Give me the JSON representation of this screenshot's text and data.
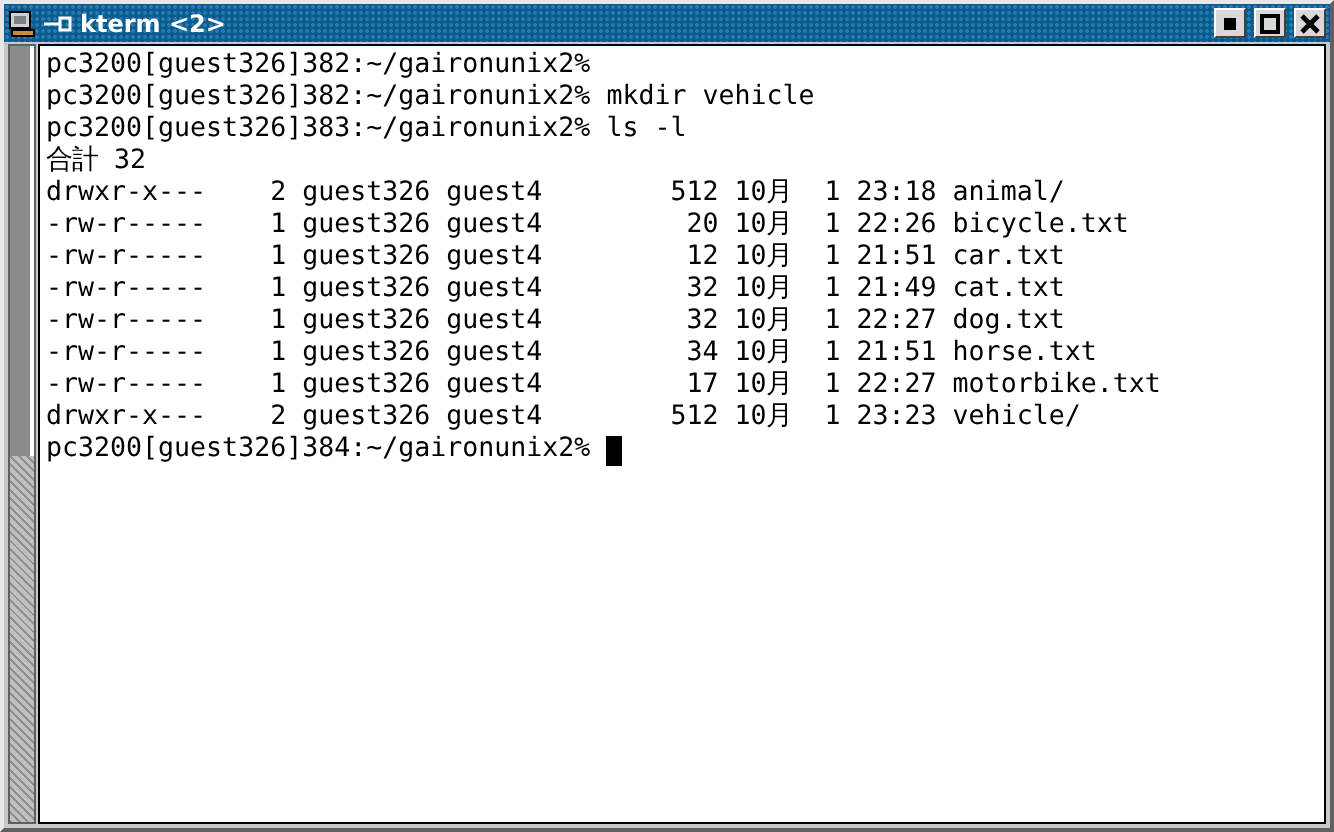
{
  "window": {
    "title": "kterm <2>"
  },
  "terminal": {
    "lines": [
      "pc3200[guest326]382:~/gaironunix2%",
      "pc3200[guest326]382:~/gaironunix2% mkdir vehicle",
      "pc3200[guest326]383:~/gaironunix2% ls -l",
      "合計 32",
      "drwxr-x---    2 guest326 guest4        512 10月  1 23:18 animal/",
      "-rw-r-----    1 guest326 guest4         20 10月  1 22:26 bicycle.txt",
      "-rw-r-----    1 guest326 guest4         12 10月  1 21:51 car.txt",
      "-rw-r-----    1 guest326 guest4         32 10月  1 21:49 cat.txt",
      "-rw-r-----    1 guest326 guest4         32 10月  1 22:27 dog.txt",
      "-rw-r-----    1 guest326 guest4         34 10月  1 21:51 horse.txt",
      "-rw-r-----    1 guest326 guest4         17 10月  1 22:27 motorbike.txt",
      "drwxr-x---    2 guest326 guest4        512 10月  1 23:23 vehicle/"
    ],
    "prompt": "pc3200[guest326]384:~/gaironunix2% "
  }
}
